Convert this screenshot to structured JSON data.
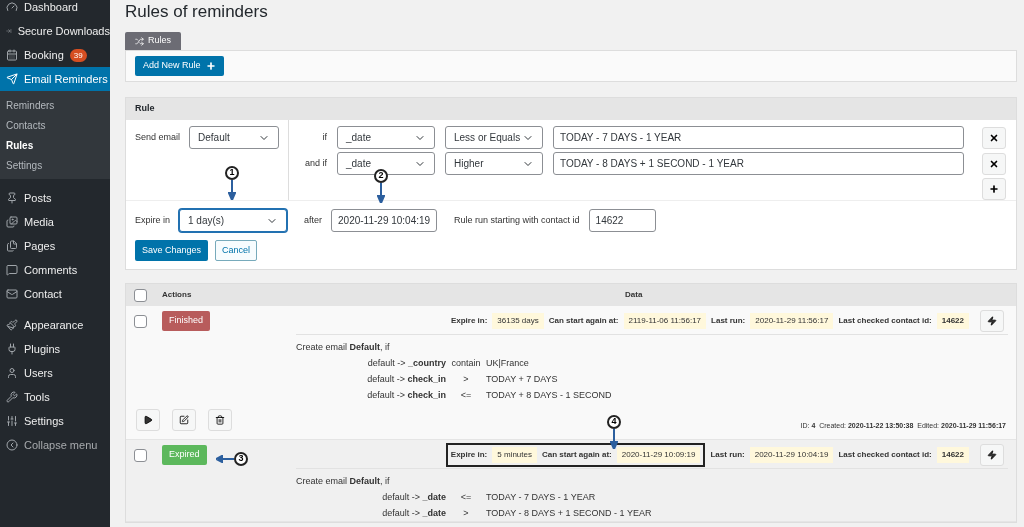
{
  "sidebar": {
    "sections": [
      {
        "items": [
          {
            "label": "Dashboard",
            "selected": false
          },
          {
            "label": "Secure Downloads",
            "selected": false
          },
          {
            "label": "Booking",
            "badge": "39",
            "selected": false
          },
          {
            "label": "Email Reminders",
            "selected": true,
            "children": [
              {
                "label": "Reminders",
                "selected": false
              },
              {
                "label": "Contacts",
                "selected": false
              },
              {
                "label": "Rules",
                "selected": true
              },
              {
                "label": "Settings",
                "selected": false
              }
            ]
          }
        ]
      },
      {
        "items": [
          {
            "label": "Posts",
            "selected": false
          },
          {
            "label": "Media",
            "selected": false
          },
          {
            "label": "Pages",
            "selected": false
          },
          {
            "label": "Comments",
            "selected": false
          },
          {
            "label": "Contact",
            "selected": false
          }
        ]
      },
      {
        "items": [
          {
            "label": "Appearance",
            "selected": false
          },
          {
            "label": "Plugins",
            "selected": false
          },
          {
            "label": "Users",
            "selected": false
          },
          {
            "label": "Tools",
            "selected": false
          },
          {
            "label": "Settings",
            "selected": false
          },
          {
            "label": "Collapse menu",
            "selected": false,
            "muted": true
          }
        ]
      }
    ]
  },
  "page_title": "Rules of reminders",
  "tabs": [
    {
      "label": "Rules",
      "selected": true
    }
  ],
  "add_button": "Add New Rule",
  "rule": {
    "title": "Rule",
    "send_email_label": "Send email",
    "send_email_value": "Default",
    "conditions": [
      {
        "label": "if",
        "field": "_date",
        "operator": "Less or Equals",
        "value": "TODAY - 7 DAYS - 1 YEAR"
      },
      {
        "label": "and if",
        "field": "_date",
        "operator": "Higher",
        "value": "TODAY - 8 DAYS + 1 SECOND - 1 YEAR"
      }
    ],
    "expire_label": "Expire in",
    "expire_value": "1 day(s)",
    "after_label": "after",
    "after_value": "2020-11-29 10:04:19",
    "contact_label": "Rule run starting with contact id",
    "contact_value": "14622",
    "save_button": "Save Changes",
    "cancel_button": "Cancel"
  },
  "table": {
    "select_all_checked": false,
    "columns": [
      "Actions",
      "Data"
    ],
    "rows": [
      {
        "checked": false,
        "status": {
          "kind": "finished",
          "label": "Finished"
        },
        "highlight_first_two": false,
        "meta": [
          {
            "label": "Expire in:",
            "value": "36135 days"
          },
          {
            "label": "Can start again at:",
            "value": "2119-11-06 11:56:17"
          },
          {
            "label": "Last run:",
            "value": "2020-11-29 11:56:17"
          },
          {
            "label": "Last checked contact id:",
            "value": "14622",
            "bold": true
          }
        ],
        "heading": "Create email **Default**, if",
        "conditions": [
          {
            "subject": "default -> **_country**",
            "operator": "contain",
            "value": "UK|France"
          },
          {
            "subject": "default -> **check_in**",
            "operator": ">",
            "value": "TODAY + 7 DAYS"
          },
          {
            "subject": "default -> **check_in**",
            "operator": "<=",
            "value": "TODAY + 8 DAYS - 1 SECOND"
          }
        ],
        "footer": "ID: **4**  Created: **2020-11-22 13:50:38**  Edited: **2020-11-29 11:56:17**"
      },
      {
        "checked": false,
        "status": {
          "kind": "expired",
          "label": "Expired"
        },
        "highlight_first_two": true,
        "meta": [
          {
            "label": "Expire in:",
            "value": "5 minutes"
          },
          {
            "label": "Can start again at:",
            "value": "2020-11-29 10:09:19"
          },
          {
            "label": "Last run:",
            "value": "2020-11-29 10:04:19"
          },
          {
            "label": "Last checked contact id:",
            "value": "14622",
            "bold": true
          }
        ],
        "heading": "Create email **Default**, if",
        "conditions": [
          {
            "subject": "default -> **_date**",
            "operator": "<=",
            "value": "TODAY - 7 DAYS - 1 YEAR"
          },
          {
            "subject": "default -> **_date**",
            "operator": ">",
            "value": "TODAY - 8 DAYS + 1 SECOND - 1 YEAR"
          }
        ]
      }
    ]
  },
  "callouts": [
    {
      "text": "1",
      "kind": "down"
    },
    {
      "text": "2",
      "kind": "down"
    },
    {
      "text": "3",
      "kind": "left"
    },
    {
      "text": "4",
      "kind": "down"
    }
  ]
}
